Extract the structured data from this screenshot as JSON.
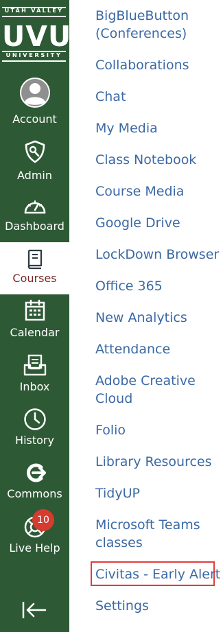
{
  "brand": {
    "top": "UTAH VALLEY",
    "mark": "UVU",
    "bottom": "UNIVERSITY",
    "nav_bg": "#2e5935",
    "link_color": "#3b69a4",
    "active_color": "#7a2828"
  },
  "global_nav": {
    "items": [
      {
        "label": "Account",
        "icon": "avatar-icon"
      },
      {
        "label": "Admin",
        "icon": "shield-icon"
      },
      {
        "label": "Dashboard",
        "icon": "speedometer-icon"
      },
      {
        "label": "Courses",
        "icon": "book-icon",
        "active": true
      },
      {
        "label": "Calendar",
        "icon": "calendar-icon"
      },
      {
        "label": "Inbox",
        "icon": "inbox-icon"
      },
      {
        "label": "History",
        "icon": "clock-icon"
      },
      {
        "label": "Commons",
        "icon": "commons-icon"
      },
      {
        "label": "Live Help",
        "icon": "lifebuoy-icon",
        "badge": "10"
      }
    ],
    "collapse_icon": "collapse-arrow-icon"
  },
  "course_nav": {
    "items": [
      {
        "label_line1": "BigBlueButton",
        "label_line2": "(Conferences)"
      },
      {
        "label_line1": "Collaborations"
      },
      {
        "label_line1": "Chat"
      },
      {
        "label_line1": "My Media"
      },
      {
        "label_line1": "Class Notebook"
      },
      {
        "label_line1": "Course Media"
      },
      {
        "label_line1": "Google Drive"
      },
      {
        "label_line1": "LockDown Browser"
      },
      {
        "label_line1": "Office 365"
      },
      {
        "label_line1": "New Analytics"
      },
      {
        "label_line1": "Attendance"
      },
      {
        "label_line1": "Adobe Creative",
        "label_line2": "Cloud"
      },
      {
        "label_line1": "Folio"
      },
      {
        "label_line1": "Library Resources"
      },
      {
        "label_line1": "TidyUP"
      },
      {
        "label_line1": "Microsoft Teams",
        "label_line2": "classes"
      },
      {
        "label_line1": "Civitas - Early Alert",
        "highlighted": true
      },
      {
        "label_line1": "Settings"
      }
    ],
    "highlight_color": "#e13c3c"
  }
}
